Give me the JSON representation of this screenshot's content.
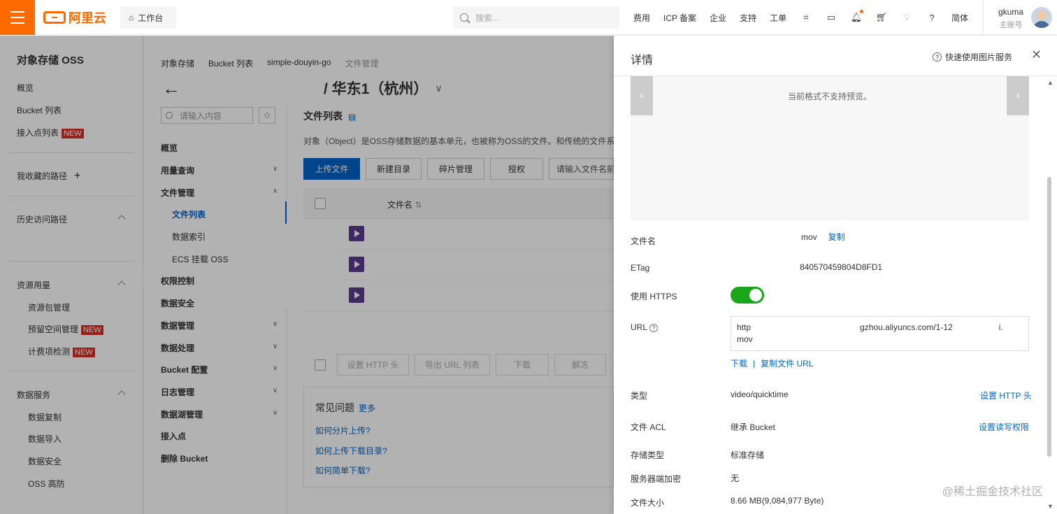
{
  "topbar": {
    "logo": "阿里云",
    "workbench": "工作台",
    "search_placeholder": "搜索...",
    "nav": [
      "费用",
      "ICP 备案",
      "企业",
      "支持",
      "工单"
    ],
    "lang": "简体",
    "user_name": "gkuma",
    "user_role": "主账号",
    "brand_color": "#ff6a00"
  },
  "sidebar": {
    "title": "对象存储 OSS",
    "overview": "概览",
    "bucket_list": "Bucket 列表",
    "access_points": "接入点列表",
    "favorites": "我收藏的路径",
    "history": "历史访问路径",
    "resources": "资源用量",
    "resource_pkg": "资源包管理",
    "reserved": "预留空间管理",
    "billing_check": "计费项检测",
    "data_service": "数据服务",
    "replication": "数据复制",
    "import": "数据导入",
    "security": "数据安全",
    "ddos": "OSS 高防",
    "new_badge": "NEW"
  },
  "main": {
    "breadcrumb": [
      "对象存储",
      "Bucket 列表",
      "simple-douyin-go",
      "文件管理"
    ],
    "region": "/ 华东1（杭州）",
    "submenu_search": "请输入内容",
    "submenu": {
      "overview": "概览",
      "usage": "用量查询",
      "file_mgmt": "文件管理",
      "file_list": "文件列表",
      "data_index": "数据索引",
      "ecs_mount": "ECS 挂载 OSS",
      "perm": "权限控制",
      "data_sec": "数据安全",
      "data_mgmt": "数据管理",
      "data_proc": "数据处理",
      "bucket_cfg": "Bucket 配置",
      "log_mgmt": "日志管理",
      "lake_mgmt": "数据湖管理",
      "access_point": "接入点",
      "delete_bucket": "删除 Bucket"
    },
    "list_title": "文件列表",
    "description": "对象（Object）是OSS存储数据的基本单元，也被称为OSS的文件。和传统的文件系统",
    "buttons": [
      "上传文件",
      "新建目录",
      "碎片管理",
      "授权",
      "请输入文件名前"
    ],
    "col_name": "文件名",
    "bottom_buttons": [
      "设置 HTTP 头",
      "导出 URL 列表",
      "下载",
      "解冻"
    ],
    "faq_title": "常见问题",
    "faq_more": "更多",
    "faq": [
      "如何分片上传?",
      "如何上传下载目录?",
      "如何简单下载?"
    ]
  },
  "panel": {
    "title": "详情",
    "quick_link": "快速使用图片服务",
    "preview_msg": "当前格式不支持预览。",
    "filename_label": "文件名",
    "filename_value": "mov",
    "copy": "复制",
    "etag_label": "ETag",
    "etag_value": "840570459804D8FD1",
    "https_label": "使用 HTTPS",
    "https_on": true,
    "url_label": "URL",
    "url_line1_a": "http",
    "url_line1_b": "gzhou.aliyuncs.com/1-12",
    "url_line1_c": "i.",
    "url_line2": "mov",
    "download": "下载",
    "copy_url": "复制文件 URL",
    "type_label": "类型",
    "type_value": "video/quicktime",
    "set_http": "设置 HTTP 头",
    "acl_label": "文件 ACL",
    "acl_value": "继承 Bucket",
    "set_acl": "设置读写权限",
    "storage_label": "存储类型",
    "storage_value": "标准存储",
    "enc_label": "服务器端加密",
    "enc_value": "无",
    "size_label": "文件大小",
    "size_value": "8.66 MB(9,084,977 Byte)"
  },
  "watermark": "@稀土掘金技术社区"
}
